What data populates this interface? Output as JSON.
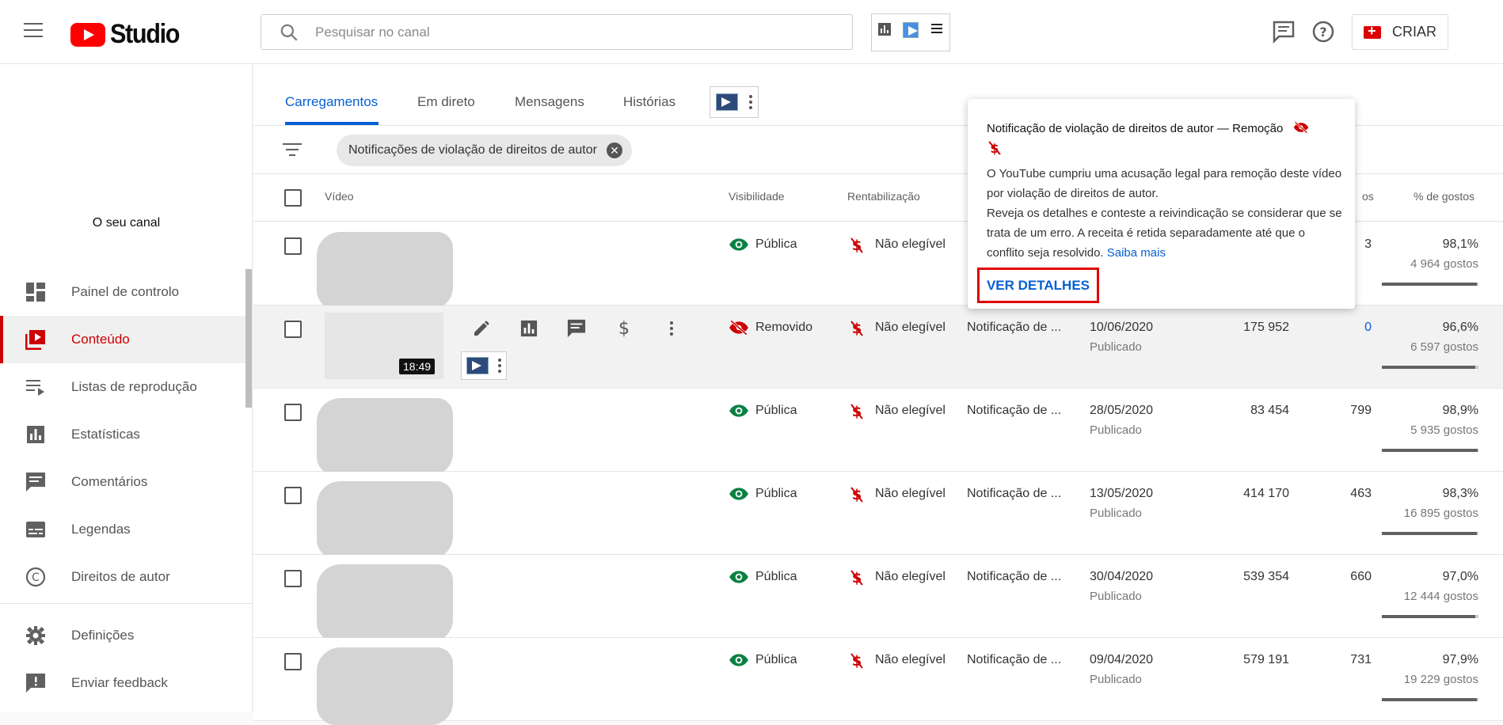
{
  "header": {
    "logo_text": "Studio",
    "search_placeholder": "Pesquisar no canal",
    "create_label": "CRIAR"
  },
  "sidebar": {
    "channel_label": "O seu canal",
    "items": [
      {
        "label": "Painel de controlo",
        "icon": "dashboard-icon"
      },
      {
        "label": "Conteúdo",
        "icon": "content-icon",
        "active": true
      },
      {
        "label": "Listas de reprodução",
        "icon": "playlist-icon"
      },
      {
        "label": "Estatísticas",
        "icon": "analytics-icon"
      },
      {
        "label": "Comentários",
        "icon": "comments-icon"
      },
      {
        "label": "Legendas",
        "icon": "subtitles-icon"
      },
      {
        "label": "Direitos de autor",
        "icon": "copyright-icon"
      },
      {
        "label": "Definições",
        "icon": "settings-icon"
      },
      {
        "label": "Enviar feedback",
        "icon": "feedback-icon"
      }
    ]
  },
  "tabs": [
    {
      "label": "Carregamentos",
      "active": true
    },
    {
      "label": "Em direto"
    },
    {
      "label": "Mensagens"
    },
    {
      "label": "Histórias"
    }
  ],
  "filter": {
    "chip_label": "Notificações de violação de direitos de autor"
  },
  "table": {
    "headers": {
      "video": "Vídeo",
      "visibility": "Visibilidade",
      "monetization": "Rentabilização",
      "comments_partial": "os",
      "likes_pct": "% de gostos"
    },
    "rows": [
      {
        "visibility": "Pública",
        "monetization": "Não elegível",
        "restriction": "",
        "date": "",
        "status": "",
        "views": "",
        "comments": "3",
        "likes_pct": "98,1%",
        "likes": "4 964 gostos",
        "like_ratio": 0.981
      },
      {
        "visibility": "Removido",
        "monetization": "Não elegível",
        "restriction": "Notificação de ...",
        "date": "10/06/2020",
        "status": "Publicado",
        "views": "175 952",
        "comments": "0",
        "likes_pct": "96,6%",
        "likes": "6 597 gostos",
        "like_ratio": 0.966,
        "duration": "18:49",
        "highlighted": true
      },
      {
        "visibility": "Pública",
        "monetization": "Não elegível",
        "restriction": "Notificação de ...",
        "date": "28/05/2020",
        "status": "Publicado",
        "views": "83 454",
        "comments": "799",
        "likes_pct": "98,9%",
        "likes": "5 935 gostos",
        "like_ratio": 0.989
      },
      {
        "visibility": "Pública",
        "monetization": "Não elegível",
        "restriction": "Notificação de ...",
        "date": "13/05/2020",
        "status": "Publicado",
        "views": "414 170",
        "comments": "463",
        "likes_pct": "98,3%",
        "likes": "16 895 gostos",
        "like_ratio": 0.983
      },
      {
        "visibility": "Pública",
        "monetization": "Não elegível",
        "restriction": "Notificação de ...",
        "date": "30/04/2020",
        "status": "Publicado",
        "views": "539 354",
        "comments": "660",
        "likes_pct": "97,0%",
        "likes": "12 444 gostos",
        "like_ratio": 0.97
      },
      {
        "visibility": "Pública",
        "monetization": "Não elegível",
        "restriction": "Notificação de ...",
        "date": "09/04/2020",
        "status": "Publicado",
        "views": "579 191",
        "comments": "731",
        "likes_pct": "97,9%",
        "likes": "19 229 gostos",
        "like_ratio": 0.979
      }
    ]
  },
  "popup": {
    "title": "Notificação de violação de direitos de autor — Remoção",
    "body_line1": "O YouTube cumpriu uma acusação legal para remoção deste vídeo por violação de direitos de autor.",
    "body_line2": "Reveja os detalhes e conteste a reivindicação se considerar que se trata de um erro. A receita é retida separadamente até que o conflito seja resolvido.",
    "learn_more": "Saiba mais",
    "details_button": "VER DETALHES"
  },
  "colors": {
    "accent": "#065fd4",
    "brand_red": "#ff0000",
    "public_green": "#0f9d58",
    "removed_red": "#cc0000"
  }
}
